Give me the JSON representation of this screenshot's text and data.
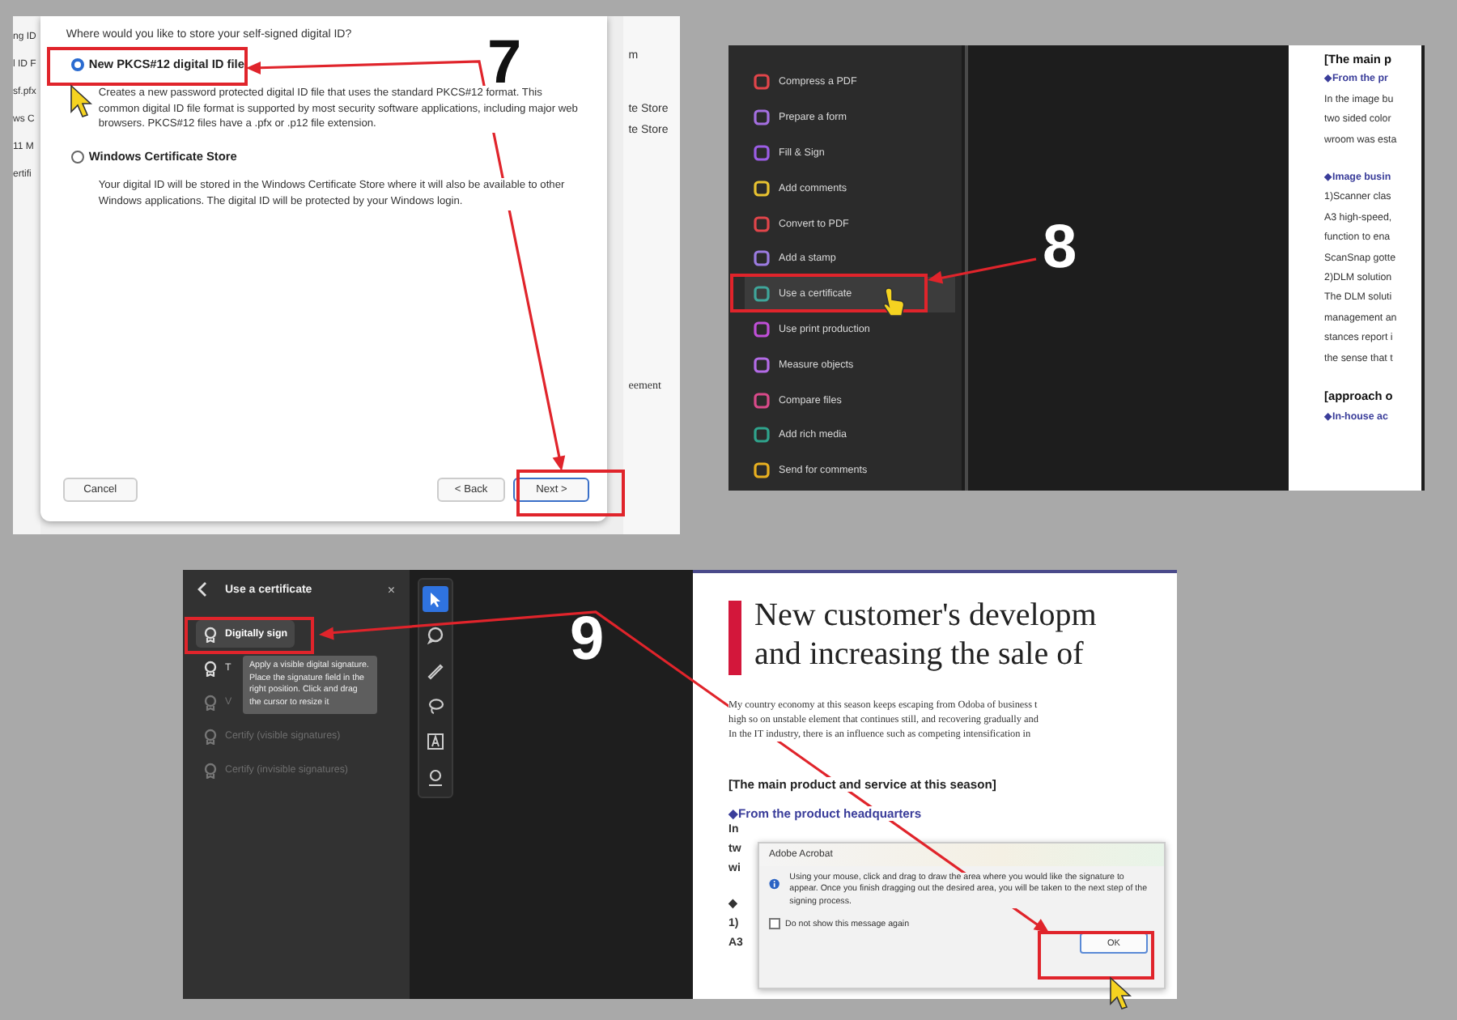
{
  "step_labels": [
    "7",
    "8",
    "9"
  ],
  "panel_a": {
    "background_left": [
      "ng ID",
      "l ID F",
      "sf.pfx",
      "ws C",
      "11 M",
      "ertifi"
    ],
    "background_right": [
      "m",
      "te Store",
      "te Store",
      "eement"
    ],
    "dialog": {
      "question": "Where would you like to store your self-signed digital ID?",
      "options": [
        {
          "label": "New PKCS#12 digital ID file",
          "description": "Creates a new password protected digital ID file that uses the standard PKCS#12 format. This common digital ID file format is supported by most security software applications, including major web browsers. PKCS#12 files have a .pfx or .p12 file extension.",
          "selected": true
        },
        {
          "label": "Windows Certificate Store",
          "description": "Your digital ID will be stored in the Windows Certificate Store where it will also be available to other Windows applications. The digital ID will be protected by your Windows login.",
          "selected": false
        }
      ],
      "buttons": [
        {
          "label": "Cancel",
          "default": false
        },
        {
          "label": "< Back",
          "default": false
        },
        {
          "label": "Next >",
          "default": true
        }
      ]
    }
  },
  "panel_b": {
    "tools": [
      {
        "label": "Compress a PDF",
        "color": "#e0454a",
        "selected": false
      },
      {
        "label": "Prepare a form",
        "color": "#a46fe0",
        "selected": false
      },
      {
        "label": "Fill & Sign",
        "color": "#9b5de5",
        "selected": false
      },
      {
        "label": "Add comments",
        "color": "#e8c230",
        "selected": false
      },
      {
        "label": "Convert to PDF",
        "color": "#e0454a",
        "selected": false
      },
      {
        "label": "Add a stamp",
        "color": "#9b7be0",
        "selected": false
      },
      {
        "label": "Use a certificate",
        "color": "#3fa59a",
        "selected": true
      },
      {
        "label": "Use print production",
        "color": "#c04fd8",
        "selected": false
      },
      {
        "label": "Measure objects",
        "color": "#b36be6",
        "selected": false
      },
      {
        "label": "Compare files",
        "color": "#d94a8a",
        "selected": false
      },
      {
        "label": "Add rich media",
        "color": "#2fa38c",
        "selected": false
      },
      {
        "label": "Send for comments",
        "color": "#e8b020",
        "selected": false
      }
    ],
    "document_lines": [
      {
        "kind": "heading",
        "text": "[The main p"
      },
      {
        "kind": "bullet",
        "text": "◆From the pr"
      },
      {
        "kind": "body",
        "text": "In the image bu"
      },
      {
        "kind": "body",
        "text": "two sided color"
      },
      {
        "kind": "body",
        "text": "wroom was esta"
      },
      {
        "kind": "gap"
      },
      {
        "kind": "bullet",
        "text": "◆Image busin"
      },
      {
        "kind": "body",
        "text": "1)Scanner clas"
      },
      {
        "kind": "body",
        "text": "A3 high-speed,"
      },
      {
        "kind": "body",
        "text": "function to ena"
      },
      {
        "kind": "body",
        "text": "ScanSnap gotte"
      },
      {
        "kind": "body",
        "text": "2)DLM solution"
      },
      {
        "kind": "body",
        "text": "The DLM soluti"
      },
      {
        "kind": "body",
        "text": "management an"
      },
      {
        "kind": "body",
        "text": "stances report i"
      },
      {
        "kind": "body",
        "text": "the sense that t"
      },
      {
        "kind": "gap"
      },
      {
        "kind": "heading",
        "text": "[approach o"
      },
      {
        "kind": "bullet",
        "text": "◆In-house ac"
      }
    ]
  },
  "panel_c": {
    "sidebar": {
      "title": "Use a certificate",
      "close": "×",
      "items": [
        {
          "label": "Digitally sign",
          "selected": true,
          "disabled": false
        },
        {
          "label": "T",
          "selected": false,
          "disabled": false
        },
        {
          "label": "V",
          "selected": false,
          "disabled": true
        },
        {
          "label": "Certify (visible signatures)",
          "selected": false,
          "disabled": true
        },
        {
          "label": "Certify (invisible signatures)",
          "selected": false,
          "disabled": true
        }
      ]
    },
    "tooltip": "Apply a visible digital signature. Place the signature field in the right position. Click and drag the cursor to resize it",
    "tools": [
      {
        "kind": "pointer",
        "selected": true
      },
      {
        "kind": "comment",
        "selected": false
      },
      {
        "kind": "pen",
        "selected": false
      },
      {
        "kind": "lasso",
        "selected": false
      },
      {
        "kind": "text",
        "selected": false
      },
      {
        "kind": "sign",
        "selected": false
      }
    ],
    "document": {
      "title_lines": [
        "New customer's developm",
        "and increasing the sale of"
      ],
      "paragraph_lines": [
        "My country economy at this season keeps escaping from Odoba of business t",
        "high so on unstable element that continues still, and recovering gradually and",
        "In the IT industry, there is an influence such as competing intensification in"
      ],
      "section_heading": "[The main product and service at this season]",
      "subheading": "◆From the product headquarters",
      "fragments": [
        {
          "kind": "line",
          "text": "In"
        },
        {
          "kind": "line",
          "text": "tw"
        },
        {
          "kind": "line",
          "text": "wi"
        },
        {
          "kind": "gap"
        },
        {
          "kind": "line",
          "text": "◆"
        },
        {
          "kind": "line",
          "text": "1)"
        },
        {
          "kind": "line",
          "text": "A3"
        }
      ]
    },
    "dialog": {
      "title": "Adobe Acrobat",
      "message": "Using your mouse, click and drag to draw the area where you would like the signature to appear. Once you finish dragging out the desired area, you will be taken to the next step of the signing process.",
      "checkbox": {
        "label": "Do not show this message again",
        "checked": false
      },
      "button": "OK"
    }
  }
}
